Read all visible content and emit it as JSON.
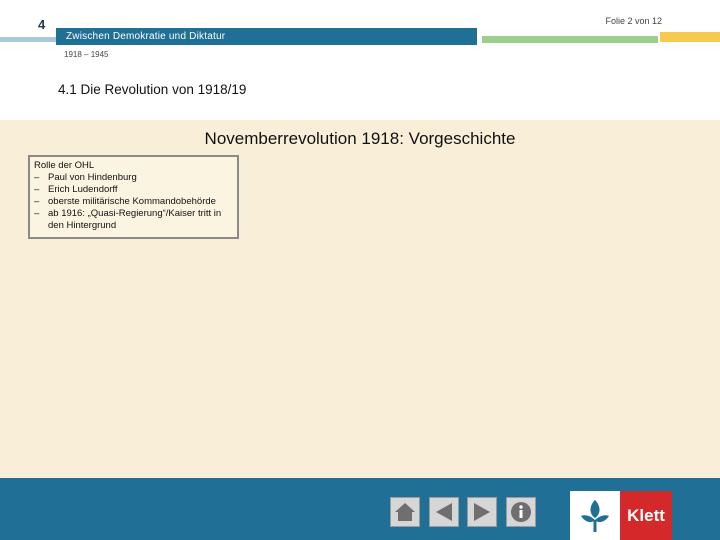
{
  "header": {
    "chapter_number": "4",
    "chapter_title": "Zwischen Demokratie und Diktatur",
    "date_range": "1918 – 1945",
    "slide_counter": "Folie 2 von 12",
    "section_title": "4.1  Die Revolution von 1918/19"
  },
  "slide": {
    "heading": "Novemberrevolution 1918: Vorgeschichte",
    "box": {
      "title": "Rolle der OHL",
      "items": [
        "Paul von Hindenburg",
        "Erich Ludendorff",
        "oberste militärische Kommandobehörde",
        "ab 1916: „Quasi-Regierung“/Kaiser tritt in den Hintergrund"
      ]
    }
  },
  "footer": {
    "nav_buttons": [
      "home-icon",
      "previous-icon",
      "next-icon",
      "info-icon"
    ],
    "logo_text": "Klett"
  },
  "colors": {
    "header_blue": "#1f6f96",
    "content_bg": "#f9efd8",
    "green_accent": "#9ccf8c",
    "yellow_accent": "#f7c94e",
    "logo_red": "#d4292b"
  }
}
